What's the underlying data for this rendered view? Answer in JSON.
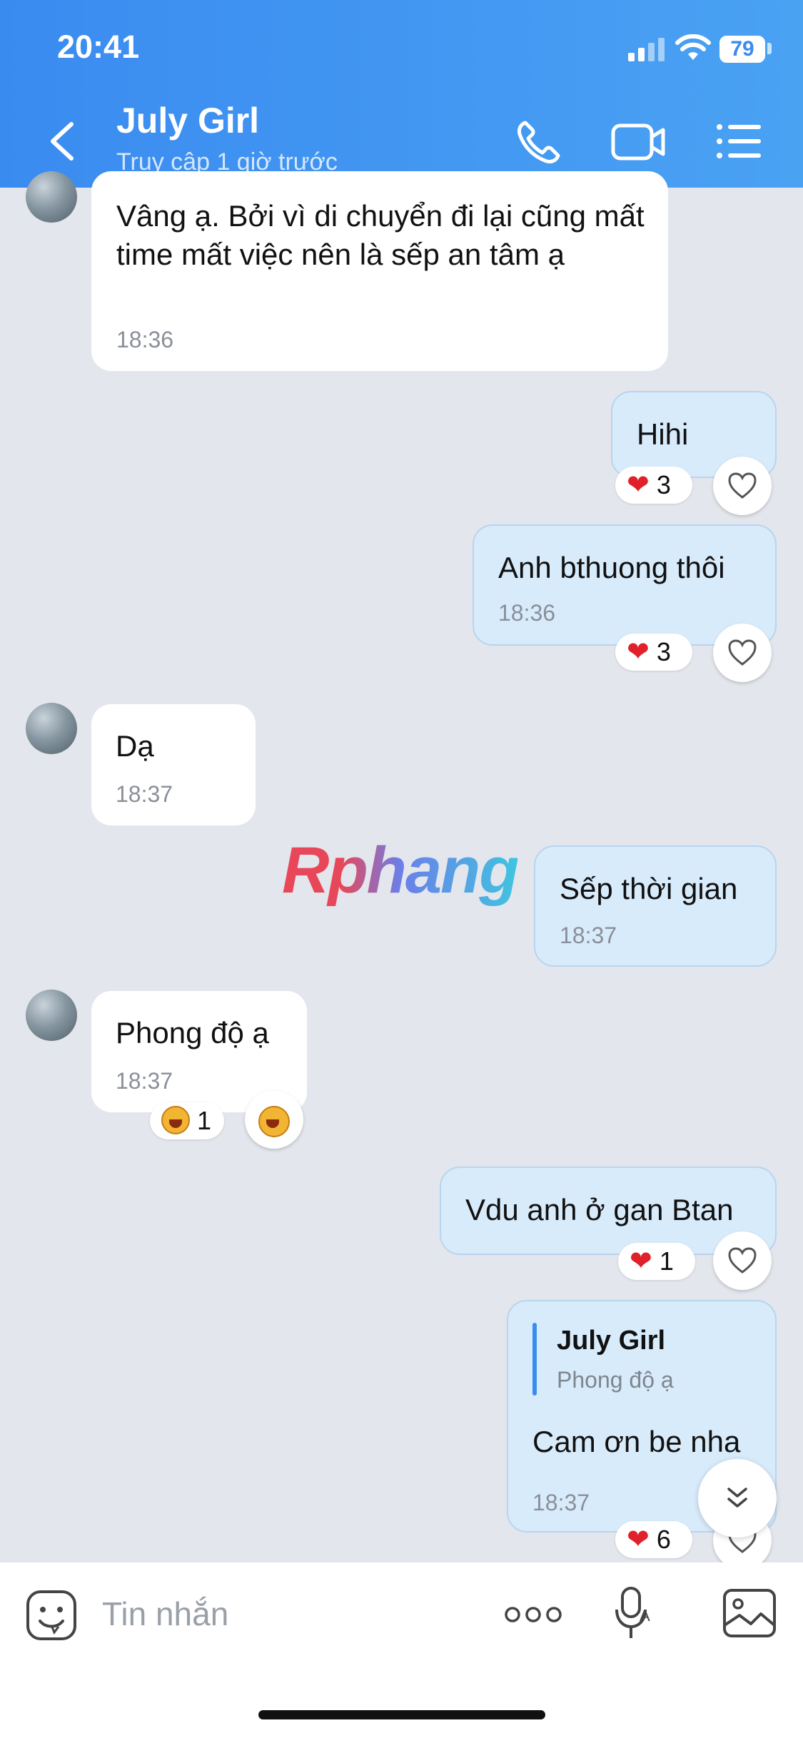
{
  "status_bar": {
    "time": "20:41",
    "battery": "79"
  },
  "header": {
    "title": "July Girl",
    "subtitle": "Truy cập 1 giờ trước",
    "icons": [
      "back-icon",
      "phone-icon",
      "video-call-icon",
      "menu-list-icon"
    ]
  },
  "messages": [
    {
      "direction": "incoming",
      "text": "Vâng ạ. Bởi vì di chuyển đi lại cũng mất time mất việc nên là sếp an tâm ạ",
      "time": "18:36"
    },
    {
      "direction": "outgoing",
      "text": "Hihi",
      "reaction": {
        "emoji": "heart",
        "count": "3"
      }
    },
    {
      "direction": "outgoing",
      "text": "Anh bthuong thôi",
      "time": "18:36",
      "reaction": {
        "emoji": "heart",
        "count": "3"
      }
    },
    {
      "direction": "incoming",
      "text": "Dạ",
      "time": "18:37"
    },
    {
      "direction": "outgoing",
      "text": "Sếp thời gian",
      "time": "18:37"
    },
    {
      "direction": "incoming",
      "text": "Phong độ ạ",
      "time": "18:37",
      "reaction": {
        "emoji": "laugh",
        "count": "1"
      }
    },
    {
      "direction": "outgoing",
      "text": "Vdu anh ở gan Btan",
      "reaction": {
        "emoji": "heart",
        "count": "1"
      }
    },
    {
      "direction": "outgoing",
      "quote": {
        "author": "July Girl",
        "text": "Phong độ ạ"
      },
      "text": "Cam ơn be nha",
      "time": "18:37",
      "reaction": {
        "emoji": "heart",
        "count": "6"
      }
    }
  ],
  "heart_glyph": "❤",
  "watermark": "Rphang",
  "input": {
    "placeholder": "Tin nhắn"
  },
  "colors": {
    "header": "#3a8bf0",
    "outgoing_bubble": "#d8ebfb",
    "incoming_bubble": "#ffffff",
    "background": "#e3e6ec"
  }
}
